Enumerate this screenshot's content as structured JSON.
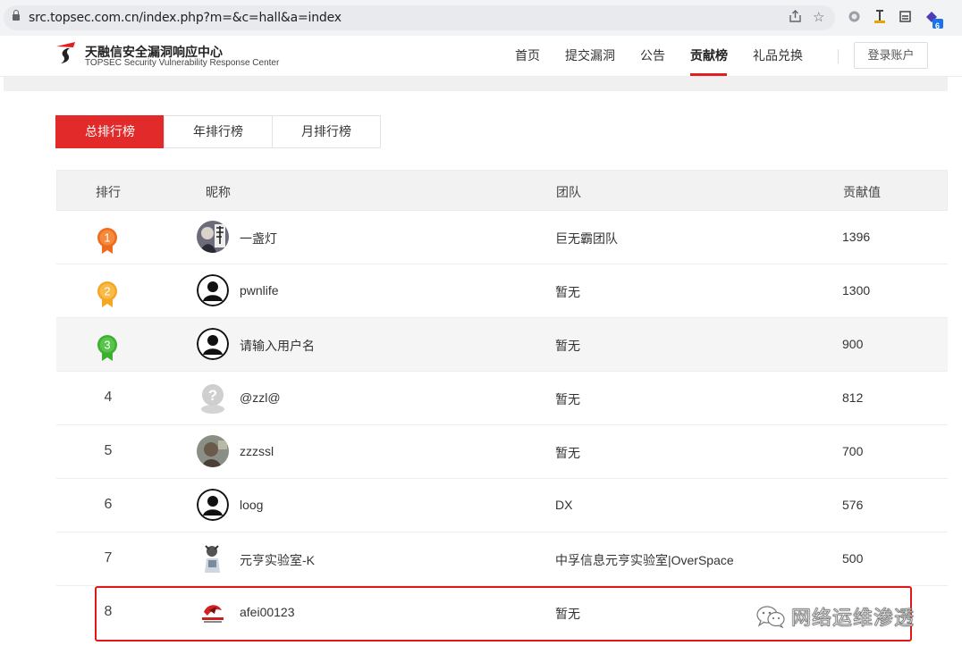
{
  "browser": {
    "url": "src.topsec.com.cn/index.php?m=&c=hall&a=index",
    "extension_badge": "6"
  },
  "header": {
    "logo_cn": "天融信安全漏洞响应中心",
    "logo_en": "TOPSEC Security Vulnerability Response Center",
    "nav": [
      "首页",
      "提交漏洞",
      "公告",
      "贡献榜",
      "礼品兑换"
    ],
    "active_nav": "贡献榜",
    "login": "登录账户"
  },
  "tabs": [
    "总排行榜",
    "年排行榜",
    "月排行榜"
  ],
  "active_tab": "总排行榜",
  "table": {
    "headers": {
      "rank": "排行",
      "nickname": "昵称",
      "team": "团队",
      "score": "贡献值"
    },
    "rows": [
      {
        "rank": "1",
        "nick": "一盏灯",
        "team": "巨无霸团队",
        "score": "1396",
        "medal_color": "#f06a1c"
      },
      {
        "rank": "2",
        "nick": "pwnlife",
        "team": "暂无",
        "score": "1300",
        "medal_color": "#f5a623"
      },
      {
        "rank": "3",
        "nick": "请输入用户名",
        "team": "暂无",
        "score": "900",
        "medal_color": "#3cb02e"
      },
      {
        "rank": "4",
        "nick": "@zzl@",
        "team": "暂无",
        "score": "812"
      },
      {
        "rank": "5",
        "nick": "zzzssl",
        "team": "暂无",
        "score": "700"
      },
      {
        "rank": "6",
        "nick": "loog",
        "team": "DX",
        "score": "576"
      },
      {
        "rank": "7",
        "nick": "元亨实验室-K",
        "team": "中孚信息元亨实验室|OverSpace",
        "score": "500"
      },
      {
        "rank": "8",
        "nick": "afei00123",
        "team": "暂无",
        "score": ""
      }
    ]
  },
  "watermark": "网络运维渗透",
  "colors": {
    "accent": "#e22a2a",
    "highlight_box": "#e01818"
  }
}
